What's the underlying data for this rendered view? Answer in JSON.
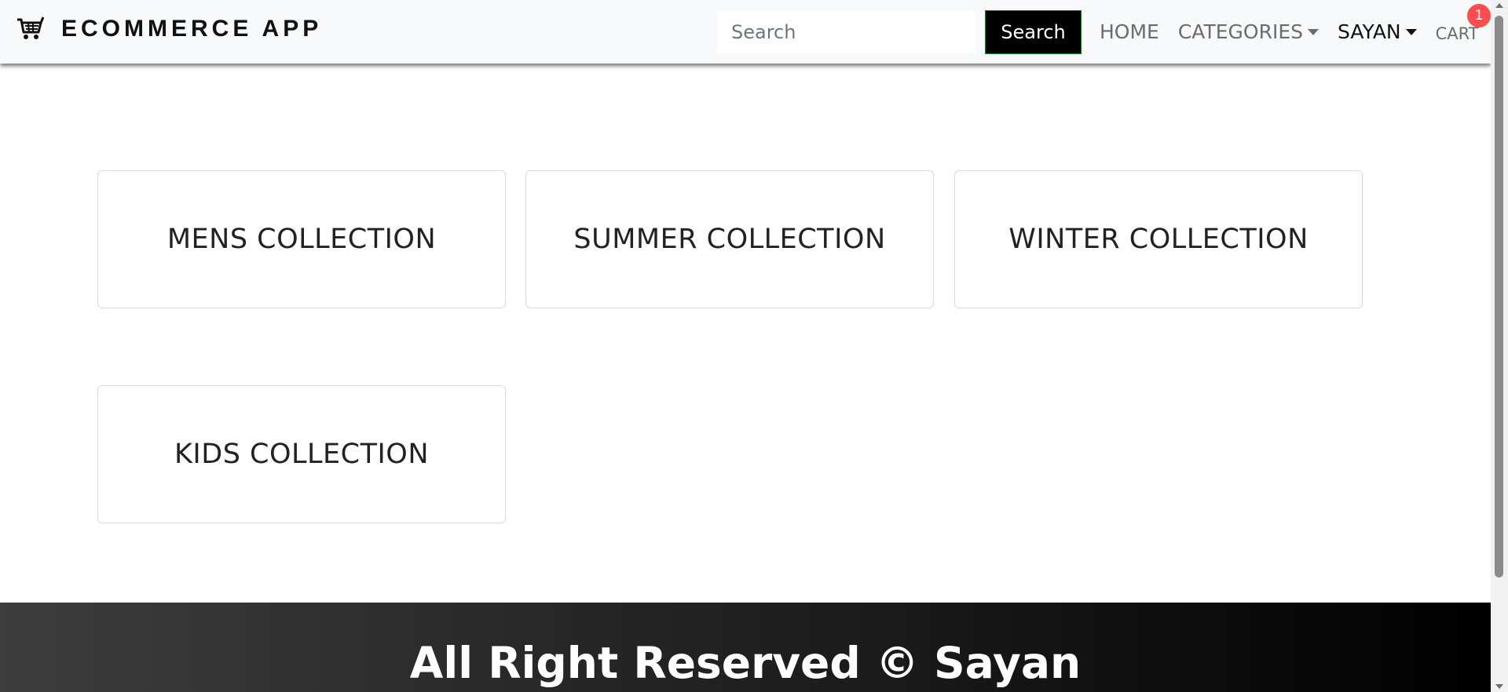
{
  "navbar": {
    "brand_icon": "shopping-cart-icon",
    "brand_text": "ECOMMERCE APP",
    "search_placeholder": "Search",
    "search_button": "Search",
    "links": {
      "home": "HOME",
      "categories": "CATEGORIES",
      "user": "SAYAN",
      "cart": "CART"
    },
    "cart_count": "1"
  },
  "collections": [
    {
      "title": "MENS COLLECTION"
    },
    {
      "title": "SUMMER COLLECTION"
    },
    {
      "title": "WINTER COLLECTION"
    },
    {
      "title": "KIDS COLLECTION"
    }
  ],
  "footer": {
    "text": "All Right Reserved © Sayan"
  },
  "colors": {
    "navbar_bg": "#f8f9fa",
    "search_button_bg": "#000000",
    "cart_badge": "#ff4d4f",
    "footer_bg": "#000000"
  }
}
